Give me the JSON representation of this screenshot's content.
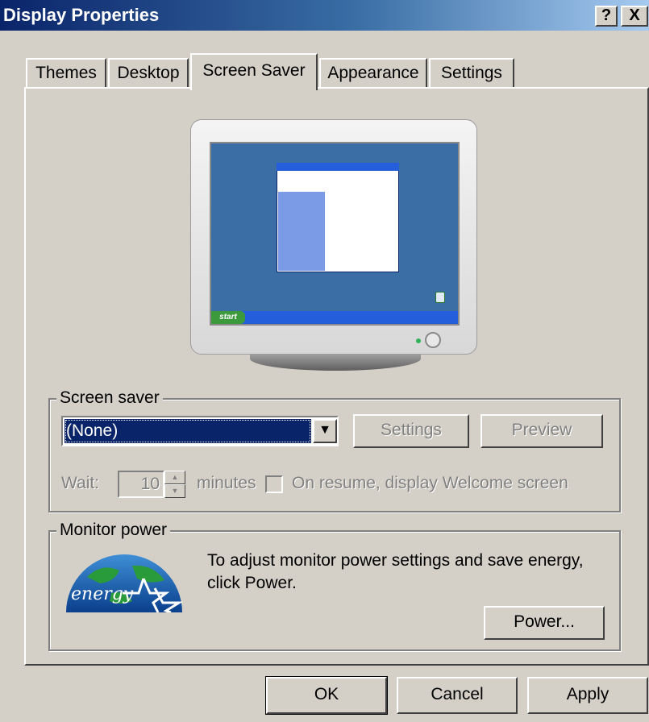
{
  "window": {
    "title": "Display Properties",
    "help_button": "?",
    "close_button": "X"
  },
  "tabs": [
    {
      "label": "Themes",
      "active": false
    },
    {
      "label": "Desktop",
      "active": false
    },
    {
      "label": "Screen Saver",
      "active": true
    },
    {
      "label": "Appearance",
      "active": false
    },
    {
      "label": "Settings",
      "active": false
    }
  ],
  "preview": {
    "mini_start_label": "start"
  },
  "screen_saver": {
    "group_label": "Screen saver",
    "selected": "(None)",
    "settings_button": "Settings",
    "preview_button": "Preview",
    "wait_label": "Wait:",
    "wait_value": "10",
    "minutes_label": "minutes",
    "resume_label": "On resume, display Welcome screen",
    "resume_checked": false
  },
  "monitor_power": {
    "group_label": "Monitor power",
    "description_line1": "To adjust monitor power settings and save energy,",
    "description_line2": "click Power.",
    "power_button": "Power...",
    "logo_text": "energy"
  },
  "footer": {
    "ok": "OK",
    "cancel": "Cancel",
    "apply": "Apply"
  },
  "colors": {
    "face": "#d4d0c8",
    "title_active": "#0a246a",
    "selection": "#0a246a",
    "disabled_text": "#808080"
  }
}
